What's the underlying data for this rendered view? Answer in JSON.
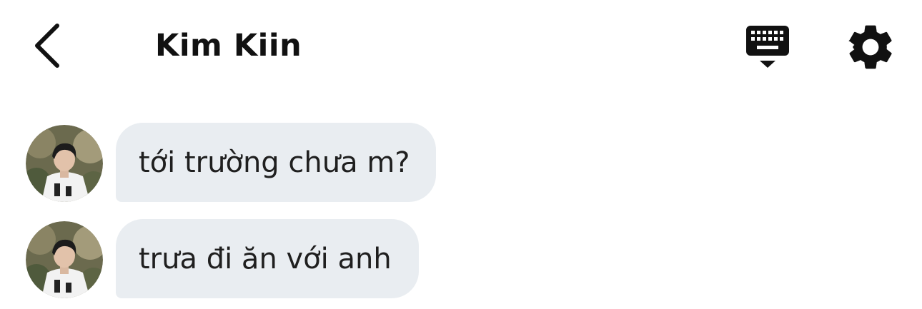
{
  "header": {
    "back_icon": "chevron-left-icon",
    "title": "Kim Kiin",
    "keyboard_icon": "keyboard-hide-icon",
    "settings_icon": "gear-icon"
  },
  "messages": [
    {
      "text": "tới trường chưa m?",
      "sender_avatar": "avatar-photo"
    },
    {
      "text": "trưa đi ăn với anh",
      "sender_avatar": "avatar-photo"
    }
  ],
  "colors": {
    "bubble_background": "#e9edf1",
    "text": "#1f1f1f",
    "icons": "#111111"
  }
}
